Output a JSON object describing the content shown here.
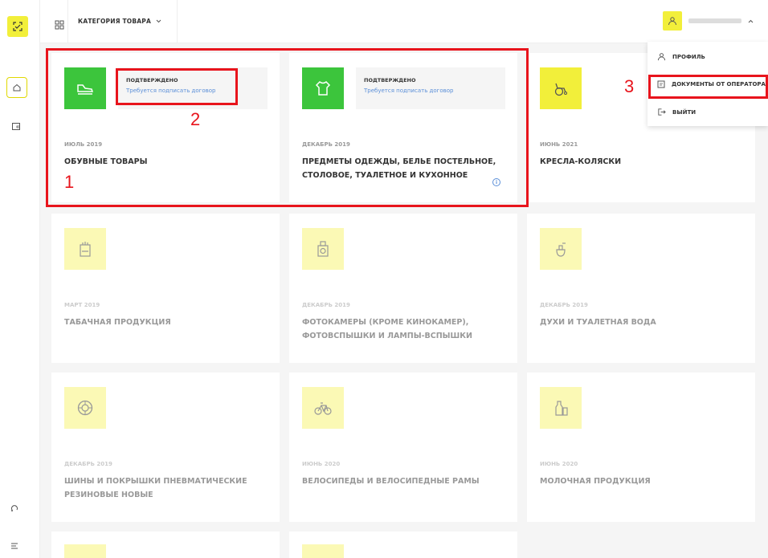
{
  "header": {
    "category_label": "КАТЕГОРИЯ ТОВАРА"
  },
  "user_menu": {
    "items": [
      {
        "label": "ПРОФИЛЬ"
      },
      {
        "label": "ДОКУМЕНТЫ ОТ ОПЕРАТОРА"
      },
      {
        "label": "ВЫЙТИ"
      }
    ]
  },
  "cards": [
    {
      "date": "ИЮЛЬ 2019",
      "title": "ОБУВНЫЕ ТОВАРЫ",
      "status": "ПОДТВЕРЖДЕНО",
      "status_note": "Требуется подписать договор",
      "icon": "shoe-icon"
    },
    {
      "date": "ДЕКАБРЬ 2019",
      "title": "ПРЕДМЕТЫ ОДЕЖДЫ, БЕЛЬЕ ПОСТЕЛЬНОЕ, СТОЛОВОЕ, ТУАЛЕТНОЕ И КУХОННОЕ",
      "status": "ПОДТВЕРЖДЕНО",
      "status_note": "Требуется подписать договор",
      "icon": "shirt-icon"
    },
    {
      "date": "ИЮНЬ 2021",
      "title": "КРЕСЛА-КОЛЯСКИ",
      "icon": "wheelchair-icon"
    },
    {
      "date": "МАРТ 2019",
      "title": "ТАБАЧНАЯ ПРОДУКЦИЯ",
      "icon": "cigarette-pack-icon"
    },
    {
      "date": "ДЕКАБРЬ 2019",
      "title": "ФОТОКАМЕРЫ (КРОМЕ КИНОКАМЕР), ФОТОВСПЫШКИ И ЛАМПЫ-ВСПЫШКИ",
      "icon": "camera-icon"
    },
    {
      "date": "ДЕКАБРЬ 2019",
      "title": "ДУХИ И ТУАЛЕТНАЯ ВОДА",
      "icon": "perfume-icon"
    },
    {
      "date": "ДЕКАБРЬ 2019",
      "title": "ШИНЫ И ПОКРЫШКИ ПНЕВМАТИЧЕСКИЕ РЕЗИНОВЫЕ НОВЫЕ",
      "icon": "tire-icon"
    },
    {
      "date": "ИЮНЬ 2020",
      "title": "ВЕЛОСИПЕДЫ И ВЕЛОСИПЕДНЫЕ РАМЫ",
      "icon": "bicycle-icon"
    },
    {
      "date": "ИЮНЬ 2020",
      "title": "МОЛОЧНАЯ ПРОДУКЦИЯ",
      "icon": "milk-icon"
    }
  ],
  "annotations": [
    "1",
    "2",
    "3"
  ],
  "colors": {
    "accent_yellow": "#f2ef3a",
    "active_green": "#3cc53c",
    "dim_yellow": "#fbf9b5",
    "link_blue": "#5b8fd8",
    "annotation_red": "#e8141c"
  }
}
